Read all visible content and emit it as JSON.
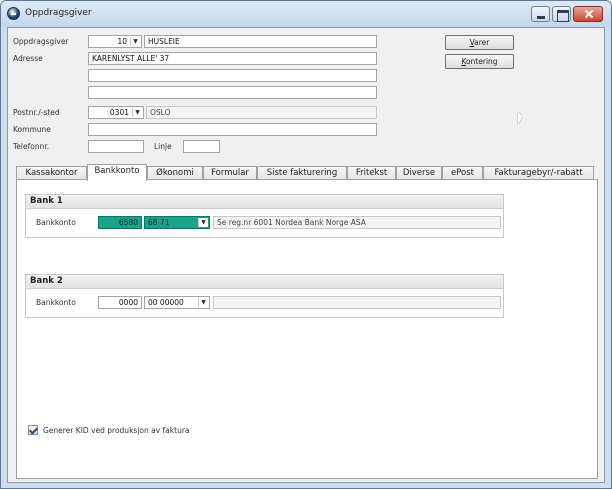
{
  "window": {
    "title": "Oppdragsgiver"
  },
  "form": {
    "oppdragsgiver_label": "Oppdragsgiver",
    "oppdragsgiver_code": "10",
    "oppdragsgiver_name": "HUSLEIE",
    "adresse_label": "Adresse",
    "adresse_line1": "KARENLYST ALLE' 37",
    "adresse_line2": "",
    "adresse_line3": "",
    "postnr_label": "Postnr./-sted",
    "postnr": "0301",
    "poststed": "OSLO",
    "kommune_label": "Kommune",
    "kommune": "",
    "telefon_label": "Telefonnr.",
    "telefon": "",
    "linje_label": "Linje",
    "linje": ""
  },
  "buttons": {
    "varer": "Varer",
    "kontering": "Kontering"
  },
  "tabs": [
    {
      "label": "Kassakontor"
    },
    {
      "label": "Bankkonto"
    },
    {
      "label": "Økonomi"
    },
    {
      "label": "Formular"
    },
    {
      "label": "Siste fakturering"
    },
    {
      "label": "Fritekst"
    },
    {
      "label": "Diverse"
    },
    {
      "label": "ePost"
    },
    {
      "label": "Fakturagebyr/-rabatt"
    }
  ],
  "active_tab": "Bankkonto",
  "bank1": {
    "title": "Bank 1",
    "label": "Bankkonto",
    "reg": "6580",
    "account": "68 71",
    "info": "Se reg.nr 6001 Nordea Bank Norge ASA"
  },
  "bank2": {
    "title": "Bank 2",
    "label": "Bankkonto",
    "reg": "0000",
    "account": "00 00000",
    "info": ""
  },
  "kid_checkbox": {
    "label": "Generer KID ved produksjon av faktura",
    "checked": true
  },
  "colors": {
    "highlight": "#1aa38a",
    "title_bar": "#c4d6ec",
    "close_button": "#c9462c"
  }
}
